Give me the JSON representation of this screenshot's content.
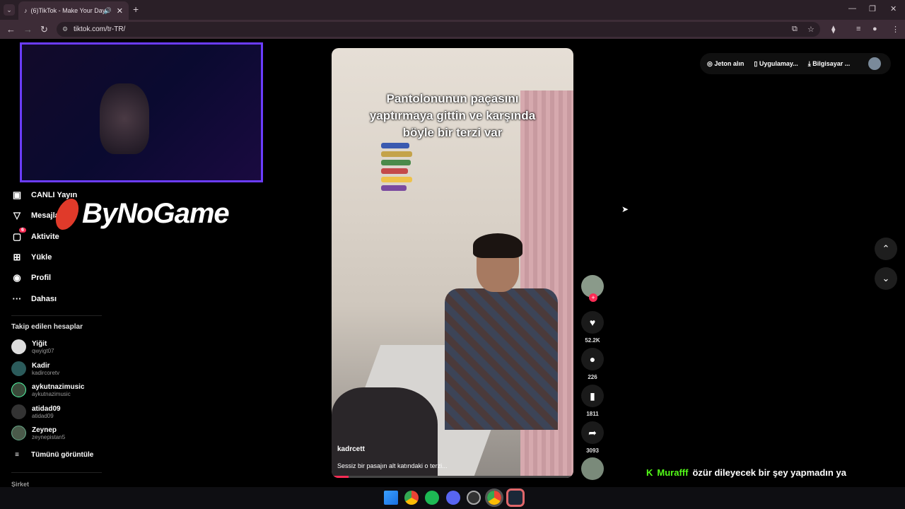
{
  "browser": {
    "tab_title": "(6)TikTok - Make Your Day",
    "tab_close": "✕",
    "new_tab": "+",
    "url": "tiktok.com/tr-TR/"
  },
  "sidebar": {
    "nav": [
      {
        "label": "CANLI Yayın",
        "icon": "live-icon"
      },
      {
        "label": "Mesajlar",
        "icon": "message-icon"
      },
      {
        "label": "Aktivite",
        "icon": "activity-icon",
        "badge": "6"
      },
      {
        "label": "Yükle",
        "icon": "upload-icon"
      },
      {
        "label": "Profil",
        "icon": "profile-icon"
      },
      {
        "label": "Dahası",
        "icon": "more-icon"
      }
    ],
    "following_title": "Takip edilen hesaplar",
    "accounts": [
      {
        "name": "Yiğit",
        "handle": "qwyigt07"
      },
      {
        "name": "Kadir",
        "handle": "kadircoretv"
      },
      {
        "name": "aykutnazimusic",
        "handle": "aykutnazimusic"
      },
      {
        "name": "atidad09",
        "handle": "atidad09"
      },
      {
        "name": "Zeynep",
        "handle": "zeynepistan5"
      }
    ],
    "see_all": "Tümünü görüntüle",
    "company": "Şirket"
  },
  "overlay": {
    "brand": "ByNoGame"
  },
  "video": {
    "caption_overlay": "Pantolonunun paçasını yaptırmaya gittin ve karşında böyle bir terzi var",
    "username": "kadrcett",
    "description": "Sessiz bir pasajın alt katındaki o terzi...",
    "progress": 0.07
  },
  "actions": {
    "likes": "52.2K",
    "comments": "226",
    "saves": "1811",
    "shares": "3093"
  },
  "top_buttons": {
    "coins": "Jeton alın",
    "app": "Uygulamay...",
    "pc": "Bilgisayar ..."
  },
  "chat": {
    "user": "Murafff",
    "message": "özür dileyecek bir şey yapmadın ya"
  }
}
